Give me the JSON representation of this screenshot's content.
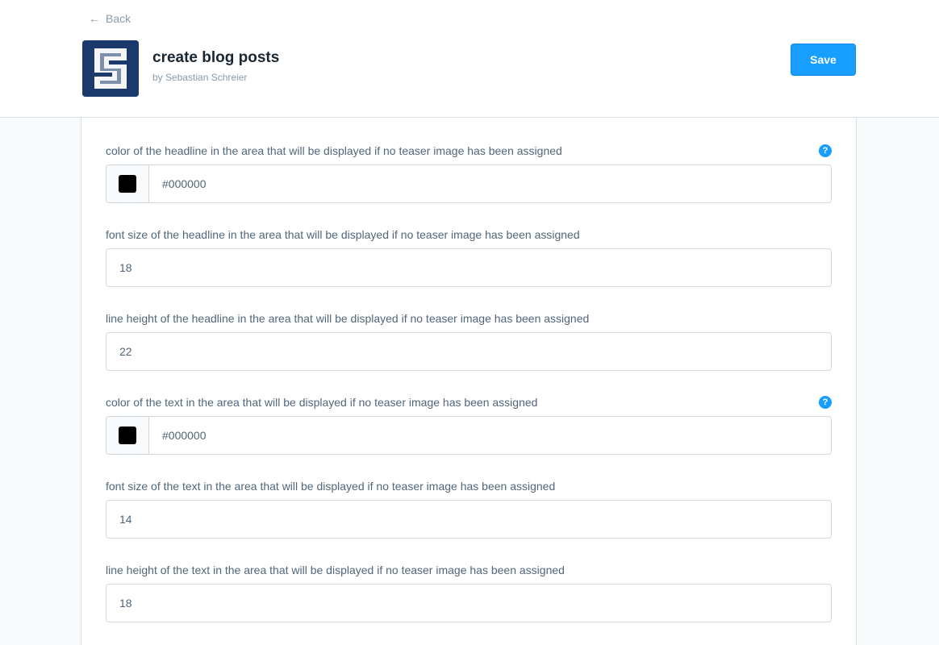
{
  "header": {
    "back_label": "Back",
    "title": "create blog posts",
    "author": "by Sebastian Schreier",
    "save_label": "Save",
    "accent_color": "#189eff",
    "logo_color": "#1b3a6b",
    "help_glyph": "?"
  },
  "fields": [
    {
      "label": "color of the headline in the area that will be displayed if no teaser image has been assigned",
      "value": "#000000",
      "type": "color",
      "help": true
    },
    {
      "label": "font size of the headline in the area that will be displayed if no teaser image has been assigned",
      "value": "18",
      "type": "number"
    },
    {
      "label": "line height of the headline in the area that will be displayed if no teaser image has been assigned",
      "value": "22",
      "type": "number"
    },
    {
      "label": "color of the text in the area that will be displayed if no teaser image has been assigned",
      "value": "#000000",
      "type": "color",
      "help": true
    },
    {
      "label": "font size of the text in the area that will be displayed if no teaser image has been assigned",
      "value": "14",
      "type": "number"
    },
    {
      "label": "line height of the text in the area that will be displayed if no teaser image has been assigned",
      "value": "18",
      "type": "number"
    }
  ]
}
